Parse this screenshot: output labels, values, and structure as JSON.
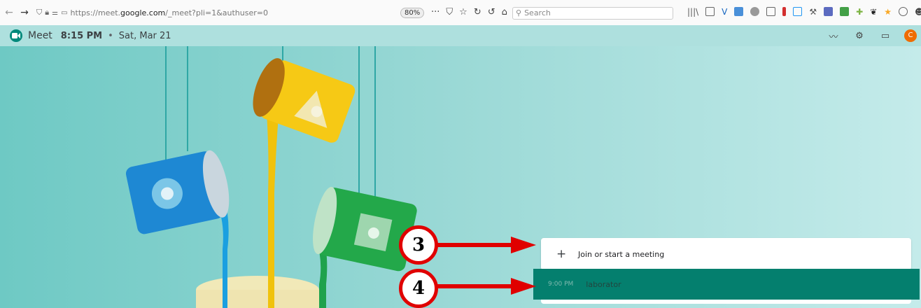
{
  "browser": {
    "url_prefix": "https://meet.",
    "url_domain": "google.com",
    "url_suffix": "/_meet?pli=1&authuser=0",
    "zoom": "80%",
    "search_placeholder": "Search"
  },
  "meet": {
    "app_name": "Meet",
    "time": "8:15 PM",
    "separator": "•",
    "date": "Sat, Mar 21",
    "avatar_initial": "C",
    "icons": [
      "activity-icon",
      "settings-icon",
      "feedback-icon"
    ]
  },
  "join": {
    "label": "Join or start a meeting"
  },
  "meeting": {
    "time": "9:00 PM",
    "name": "laborator"
  },
  "annotations": [
    {
      "label": "3"
    },
    {
      "label": "4"
    }
  ],
  "colors": {
    "background": "#aee0de",
    "meeting_card": "#047f6e",
    "annotation_red": "#e00000",
    "avatar": "#ef6c00",
    "meet_brand": "#00897b"
  }
}
